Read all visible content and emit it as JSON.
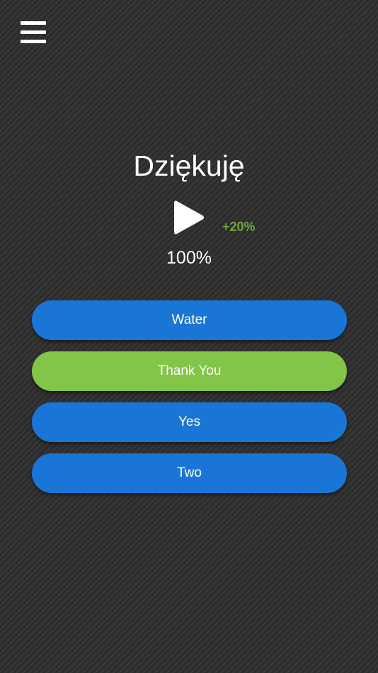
{
  "header": {
    "menu_icon": "hamburger-menu-icon"
  },
  "question": {
    "word": "Dziękuję",
    "play_icon": "play-icon",
    "bonus": "+20%",
    "score": "100%"
  },
  "answers": [
    {
      "label": "Water",
      "state": "default",
      "color": "#1976d6"
    },
    {
      "label": "Thank You",
      "state": "correct",
      "color": "#83c548"
    },
    {
      "label": "Yes",
      "state": "default",
      "color": "#1976d6"
    },
    {
      "label": "Two",
      "state": "default",
      "color": "#1976d6"
    }
  ],
  "colors": {
    "background": "#2e2e2e",
    "bonus_text": "#6ea83b",
    "button_blue": "#1976d6",
    "button_green": "#83c548"
  }
}
